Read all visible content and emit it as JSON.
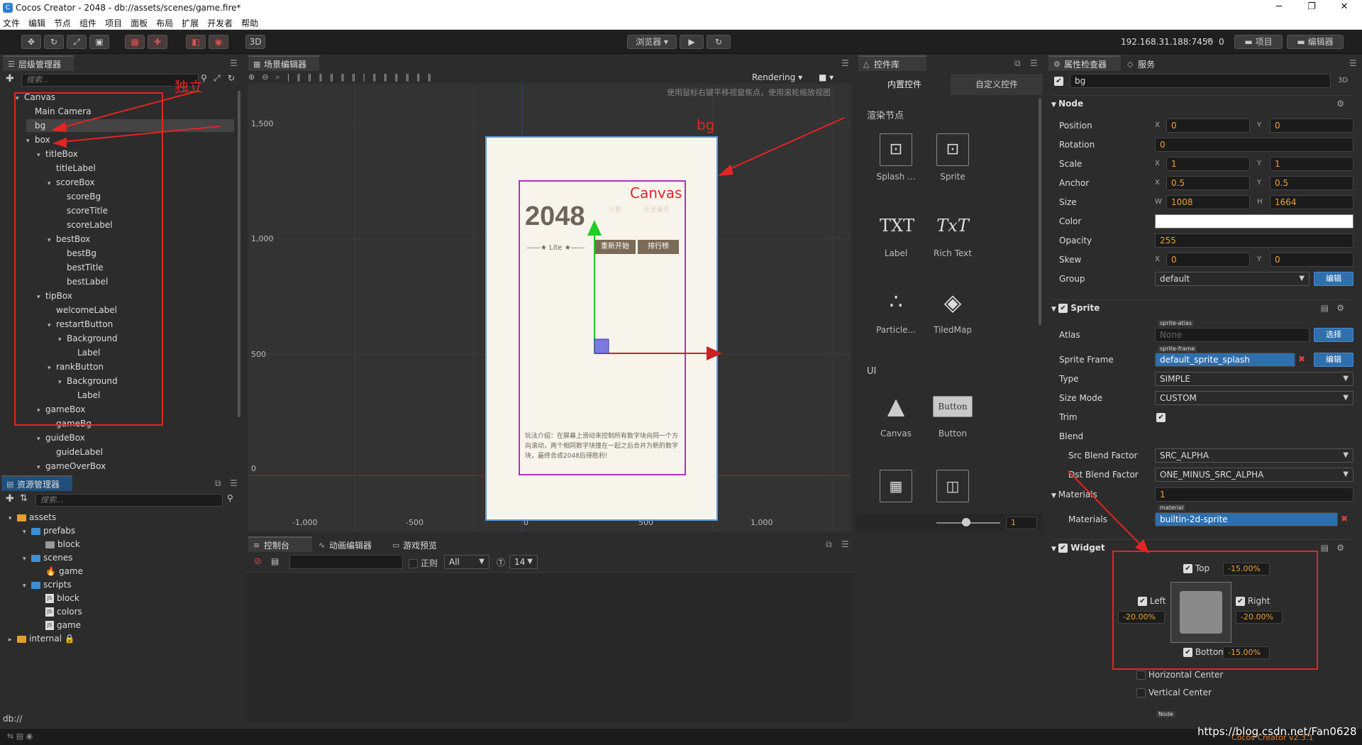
{
  "window": {
    "title": "Cocos Creator - 2048 - db://assets/scenes/game.fire*",
    "minimize": "─",
    "maximize": "❐",
    "close": "✕"
  },
  "menu": [
    "文件",
    "编辑",
    "节点",
    "组件",
    "项目",
    "面板",
    "布局",
    "扩展",
    "开发者",
    "帮助"
  ],
  "toolbar": {
    "browser_label": "浏览器 ▾",
    "three_d": "3D",
    "ip": "192.168.31.188:7456",
    "wifi_count": "0",
    "project_btn": "项目",
    "editor_btn": "编辑器"
  },
  "hierarchy": {
    "tab": "层级管理器",
    "search_placeholder": "搜索...",
    "nodes": [
      {
        "label": "Canvas",
        "depth": 0,
        "arrow": "▾"
      },
      {
        "label": "Main Camera",
        "depth": 1,
        "arrow": ""
      },
      {
        "label": "bg",
        "depth": 1,
        "arrow": ""
      },
      {
        "label": "box",
        "depth": 1,
        "arrow": "▾"
      },
      {
        "label": "titleBox",
        "depth": 2,
        "arrow": "▾"
      },
      {
        "label": "titleLabel",
        "depth": 3,
        "arrow": ""
      },
      {
        "label": "scoreBox",
        "depth": 3,
        "arrow": "▾"
      },
      {
        "label": "scoreBg",
        "depth": 4,
        "arrow": ""
      },
      {
        "label": "scoreTitle",
        "depth": 4,
        "arrow": ""
      },
      {
        "label": "scoreLabel",
        "depth": 4,
        "arrow": ""
      },
      {
        "label": "bestBox",
        "depth": 3,
        "arrow": "▾"
      },
      {
        "label": "bestBg",
        "depth": 4,
        "arrow": ""
      },
      {
        "label": "bestTitle",
        "depth": 4,
        "arrow": ""
      },
      {
        "label": "bestLabel",
        "depth": 4,
        "arrow": ""
      },
      {
        "label": "tipBox",
        "depth": 2,
        "arrow": "▾"
      },
      {
        "label": "welcomeLabel",
        "depth": 3,
        "arrow": ""
      },
      {
        "label": "restartButton",
        "depth": 3,
        "arrow": "▾"
      },
      {
        "label": "Background",
        "depth": 4,
        "arrow": "▾"
      },
      {
        "label": "Label",
        "depth": 5,
        "arrow": ""
      },
      {
        "label": "rankButton",
        "depth": 3,
        "arrow": "▾"
      },
      {
        "label": "Background",
        "depth": 4,
        "arrow": "▾"
      },
      {
        "label": "Label",
        "depth": 5,
        "arrow": ""
      },
      {
        "label": "gameBox",
        "depth": 2,
        "arrow": "▾"
      },
      {
        "label": "gameBg",
        "depth": 3,
        "arrow": ""
      },
      {
        "label": "guideBox",
        "depth": 2,
        "arrow": "▾"
      },
      {
        "label": "guideLabel",
        "depth": 3,
        "arrow": ""
      },
      {
        "label": "gameOverBox",
        "depth": 2,
        "arrow": "▾"
      }
    ],
    "annotation": "独立"
  },
  "assets": {
    "tab": "资源管理器",
    "search_placeholder": "搜索...",
    "items": [
      {
        "label": "assets",
        "depth": 0,
        "kind": "db",
        "arrow": "▾"
      },
      {
        "label": "prefabs",
        "depth": 1,
        "kind": "folder",
        "arrow": "▾"
      },
      {
        "label": "block",
        "depth": 2,
        "kind": "prefab",
        "arrow": ""
      },
      {
        "label": "scenes",
        "depth": 1,
        "kind": "folder",
        "arrow": "▾"
      },
      {
        "label": "game",
        "depth": 2,
        "kind": "scene",
        "arrow": ""
      },
      {
        "label": "scripts",
        "depth": 1,
        "kind": "folder",
        "arrow": "▾"
      },
      {
        "label": "block",
        "depth": 2,
        "kind": "js",
        "arrow": ""
      },
      {
        "label": "colors",
        "depth": 2,
        "kind": "js",
        "arrow": ""
      },
      {
        "label": "game",
        "depth": 2,
        "kind": "js",
        "arrow": ""
      },
      {
        "label": "internal",
        "depth": 0,
        "kind": "db-locked",
        "arrow": "▸"
      }
    ],
    "status": "db://"
  },
  "scene": {
    "tab": "场景编辑器",
    "rendering": "Rendering",
    "hint": "使用鼠标右键平移视窗焦点，使用滚轮缩放视图",
    "y_labels": [
      "1,500",
      "1,000",
      "500",
      "0"
    ],
    "x_labels": [
      "-1,000",
      "-500",
      "0",
      "500",
      "1,000"
    ],
    "game": {
      "title": "2048",
      "score_title": "分数",
      "best_title": "历史最佳",
      "lite": "——★ Lite ★——",
      "restart": "重新开始",
      "rank": "排行榜",
      "guide": "玩法介绍：在屏幕上滑动来控制所有数字块向同一个方向滚动，两个相同数字块撞在一起之后合并为新的数字块，最终合成2048后得胜利!"
    },
    "annot_bg": "bg",
    "annot_canvas": "Canvas"
  },
  "library": {
    "tab": "控件库",
    "subtab_builtin": "内置控件",
    "subtab_custom": "自定义控件",
    "section_render": "渲染节点",
    "section_ui": "UI",
    "items": [
      {
        "label": "Splash ...",
        "icon": "sprite-splash-icon",
        "glyph": "⊡"
      },
      {
        "label": "Sprite",
        "icon": "sprite-icon",
        "glyph": "⊡"
      },
      {
        "label": "Label",
        "icon": "label-icon",
        "glyph": "TXT"
      },
      {
        "label": "Rich Text",
        "icon": "richtext-icon",
        "glyph": "TxT"
      },
      {
        "label": "Particle...",
        "icon": "particle-icon",
        "glyph": "∴"
      },
      {
        "label": "TiledMap",
        "icon": "tiledmap-icon",
        "glyph": "◈"
      },
      {
        "label": "Canvas",
        "icon": "canvas-icon",
        "glyph": "▲"
      },
      {
        "label": "Button",
        "icon": "button-icon",
        "glyph": "Button"
      }
    ],
    "slider_value": "1"
  },
  "console": {
    "tabs": [
      "控制台",
      "动画编辑器",
      "游戏预览"
    ],
    "regex_label": "正则",
    "level": "All",
    "font_size": "14"
  },
  "inspector": {
    "tab": "属性检查器",
    "tab2": "服务",
    "node_name": "bg",
    "three_d": "3D",
    "node_section": "Node",
    "position": {
      "label": "Position",
      "x": "0",
      "y": "0"
    },
    "rotation": {
      "label": "Rotation",
      "value": "0"
    },
    "scale": {
      "label": "Scale",
      "x": "1",
      "y": "1"
    },
    "anchor": {
      "label": "Anchor",
      "x": "0.5",
      "y": "0.5"
    },
    "size": {
      "label": "Size",
      "w": "1008",
      "h": "1664"
    },
    "color": {
      "label": "Color",
      "value": "#ffffff"
    },
    "opacity": {
      "label": "Opacity",
      "value": "255"
    },
    "skew": {
      "label": "Skew",
      "x": "0",
      "y": "0"
    },
    "group": {
      "label": "Group",
      "value": "default",
      "edit": "编辑"
    },
    "sprite_section": "Sprite",
    "atlas": {
      "label": "Atlas",
      "tag": "sprite-atlas",
      "value": "None",
      "btn": "选择"
    },
    "sprite_frame": {
      "label": "Sprite Frame",
      "tag": "sprite-frame",
      "value": "default_sprite_splash",
      "btn": "编辑"
    },
    "type": {
      "label": "Type",
      "value": "SIMPLE"
    },
    "size_mode": {
      "label": "Size Mode",
      "value": "CUSTOM"
    },
    "trim": {
      "label": "Trim"
    },
    "blend": {
      "label": "Blend"
    },
    "src_blend": {
      "label": "Src Blend Factor",
      "value": "SRC_ALPHA"
    },
    "dst_blend": {
      "label": "Dst Blend Factor",
      "value": "ONE_MINUS_SRC_ALPHA"
    },
    "materials_count": {
      "label": "Materials",
      "value": "1"
    },
    "materials": {
      "label": "Materials",
      "tag": "material",
      "value": "builtin-2d-sprite"
    },
    "widget_section": "Widget",
    "widget": {
      "top": "Top",
      "top_value": "-15.00%",
      "left": "Left",
      "left_value": "-20.00%",
      "right": "Right",
      "right_value": "-20.00%",
      "bottom": "Bottom",
      "bottom_value": "-15.00%",
      "hcenter": "Horizontal Center",
      "vcenter": "Vertical Center",
      "node_tag": "Node"
    }
  },
  "footer": {
    "watermark": "https://blog.csdn.net/Fan0628",
    "version": "Cocos Creator v2.3.1"
  },
  "colors": {
    "accent_blue": "#2f6fad",
    "annotation_red": "#e52424",
    "value_orange": "#f0a030"
  }
}
